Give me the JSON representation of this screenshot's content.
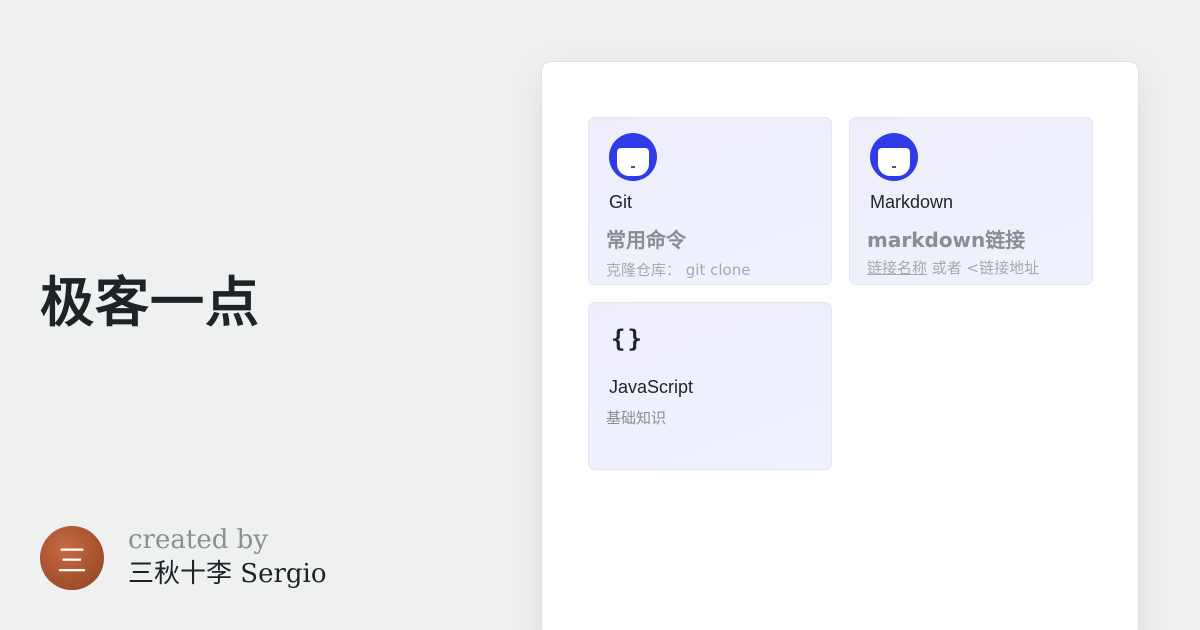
{
  "site": {
    "title": "极客一点"
  },
  "author": {
    "avatar_text": "三",
    "created_by": "created by",
    "name": "三秋十李 Sergio"
  },
  "cards": [
    {
      "name": "Git",
      "subtitle": "常用命令",
      "desc_prefix": "克隆仓库：",
      "desc_rest": " git clone",
      "icon": "git-logo-icon"
    },
    {
      "name": "Markdown",
      "subtitle": "markdown链接",
      "desc_prefix": "链接名称",
      "desc_rest": " 或者 <链接地址",
      "icon": "markdown-logo-icon"
    },
    {
      "name": "JavaScript",
      "description": "基础知识",
      "icon_text": "{}",
      "icon": "braces-icon"
    }
  ],
  "colors": {
    "accent": "#2f3be6",
    "avatar": "#a8532f",
    "background": "#eff1f1"
  }
}
